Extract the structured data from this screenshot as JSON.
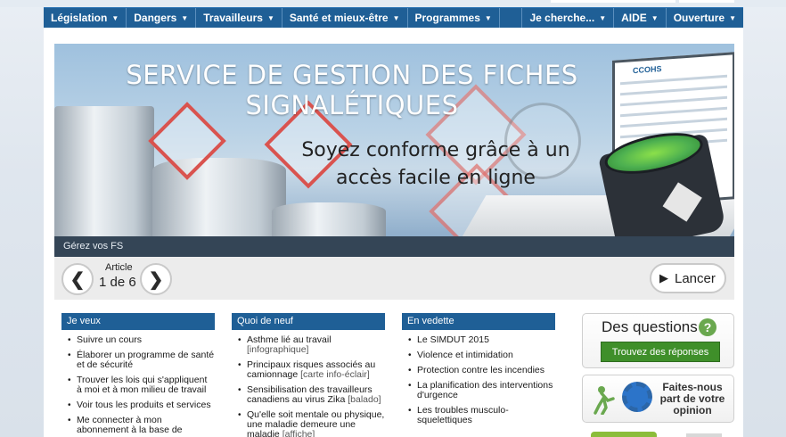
{
  "nav": {
    "left_items": [
      {
        "label": "Législation"
      },
      {
        "label": "Dangers"
      },
      {
        "label": "Travailleurs"
      },
      {
        "label": "Santé et mieux-être"
      },
      {
        "label": "Programmes"
      }
    ],
    "right_items": [
      {
        "label": "Je cherche..."
      },
      {
        "label": "AIDE"
      },
      {
        "label": "Ouverture"
      }
    ]
  },
  "banner": {
    "title_line1": "SERVICE DE GESTION DES FICHES",
    "title_line2": "SIGNALÉTIQUES",
    "subtitle_line1": "Soyez conforme grâce à un",
    "subtitle_line2": "accès facile en ligne",
    "screen_logo": "CCOHS",
    "caption": "Gérez vos FS"
  },
  "carousel": {
    "article_label": "Article",
    "article_count": "1 de 6",
    "launch_label": "Lancer"
  },
  "columns": {
    "je_veux": {
      "title": "Je veux",
      "items": [
        {
          "text": "Suivre un cours"
        },
        {
          "text": "Élaborer un programme de santé et de sécurité"
        },
        {
          "text": "Trouver les lois qui s'appliquent à moi et à mon milieu de travail"
        },
        {
          "text": "Voir tous les produits et services"
        },
        {
          "text": "Me connecter à mon abonnement à la base de"
        }
      ]
    },
    "quoi_de_neuf": {
      "title": "Quoi de neuf",
      "items": [
        {
          "text": "Asthme lié au travail",
          "note": "[infographique]"
        },
        {
          "text": "Principaux risques associés au camionnage",
          "note": "[carte info-éclair]"
        },
        {
          "text": "Sensibilisation des travailleurs canadiens au virus Zika",
          "note": "[balado]"
        },
        {
          "text": "Qu'elle soit mentale ou physique, une maladie demeure une maladie",
          "note": "[affiche]"
        }
      ]
    },
    "en_vedette": {
      "title": "En vedette",
      "items": [
        {
          "text": "Le SIMDUT 2015"
        },
        {
          "text": "Violence et intimidation"
        },
        {
          "text": "Protection contre les incendies"
        },
        {
          "text": "La planification des interventions d'urgence"
        },
        {
          "text": "Les troubles musculo-squelettiques"
        }
      ]
    }
  },
  "questions_box": {
    "title": "Des questions",
    "button_label": "Trouvez des réponses"
  },
  "feedback_box": {
    "text": "Faites-nous part de votre opinion"
  },
  "colors": {
    "nav_blue": "#1f5f96",
    "button_green": "#3f8f2a",
    "caption_bar": "#344556"
  }
}
